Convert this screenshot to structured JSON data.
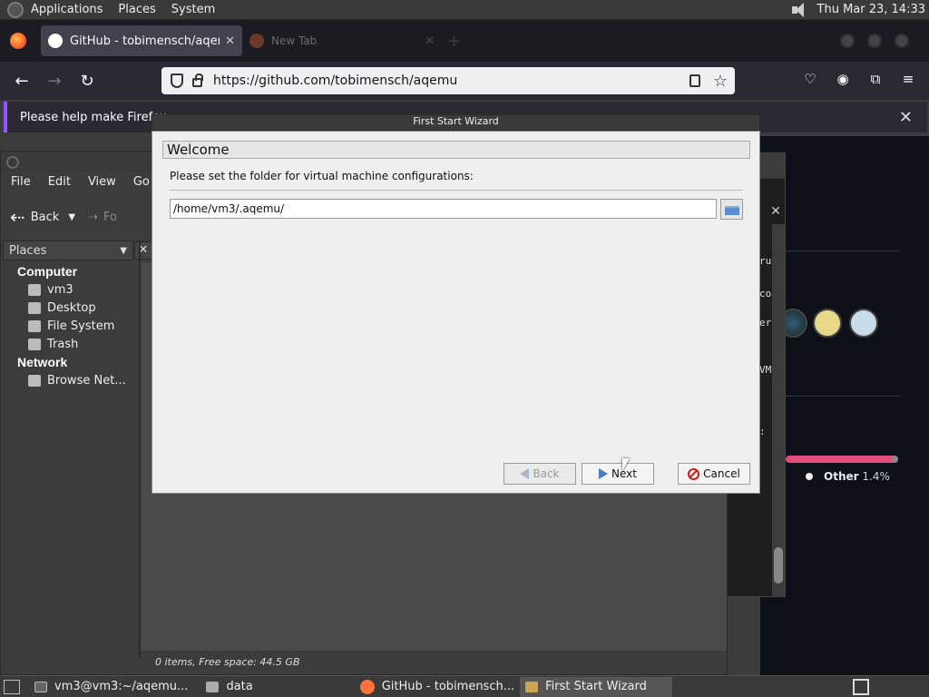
{
  "top_panel": {
    "menus": [
      "Applications",
      "Places",
      "System"
    ],
    "clock": "Thu Mar 23, 14:33",
    "volume_icon": "speaker-icon"
  },
  "firefox": {
    "tabs": [
      {
        "title": "GitHub - tobimensch/aqemu",
        "active": true
      },
      {
        "title": "New Tab",
        "active": false
      }
    ],
    "url": "https://github.com/tobimensch/aqemu",
    "notification": "Please help make Firefox"
  },
  "github_page": {
    "other_label": "Other",
    "other_percent": "1.4%",
    "bar_color": "#e34c7a"
  },
  "terminal_snippets": [
    "ru",
    "co",
    "er",
    "VM",
    ":"
  ],
  "file_manager": {
    "menus": [
      "File",
      "Edit",
      "View",
      "Go"
    ],
    "back_label": "Back",
    "forward_label": "Fo",
    "side_header": "Places",
    "groups": [
      {
        "label": "Computer",
        "items": [
          "vm3",
          "Desktop",
          "File System",
          "Trash"
        ]
      },
      {
        "label": "Network",
        "items": [
          "Browse Net..."
        ]
      }
    ],
    "status": "0 items, Free space: 44.5 GB"
  },
  "wizard": {
    "window_title": "First Start Wizard",
    "page_title": "Welcome",
    "prompt": "Please set the folder for virtual machine configurations:",
    "path_value": "/home/vm3/.aqemu/",
    "back_label": "Back",
    "next_label": "Next",
    "cancel_label": "Cancel"
  },
  "taskbar": {
    "tasks": [
      {
        "label": "vm3@vm3:~/aqemu...",
        "icon": "terminal-icon"
      },
      {
        "label": "data",
        "icon": "folder-icon"
      },
      {
        "label": "GitHub - tobimensch...",
        "icon": "firefox-icon"
      },
      {
        "label": "First Start Wizard",
        "icon": "wizard-icon",
        "active": true
      }
    ]
  }
}
